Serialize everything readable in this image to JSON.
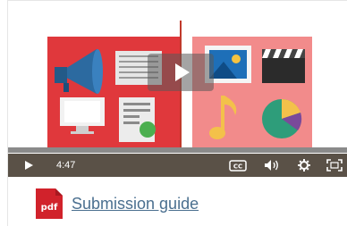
{
  "player": {
    "current_time": "4:47",
    "play_label": "Play",
    "cc_label": "CC",
    "colors": {
      "left_panel": "#e0383c",
      "right_panel": "#f28b8b",
      "controls_bg": "#5a5147"
    },
    "thumbnail_icons": [
      "megaphone-icon",
      "document-icon",
      "monitor-icon",
      "report-icon",
      "image-icon",
      "clapperboard-icon",
      "music-note-icon",
      "pie-chart-icon"
    ]
  },
  "attachment": {
    "icon_label": "pdf",
    "link_text": "Submission guide"
  }
}
